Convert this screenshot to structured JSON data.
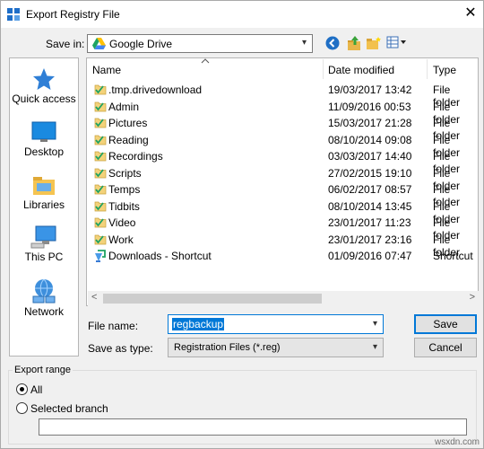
{
  "window": {
    "title": "Export Registry File",
    "close_symbol": "✕"
  },
  "location": {
    "label": "Save in:",
    "current": "Google Drive"
  },
  "places": [
    {
      "label": "Quick access",
      "icon": "star-icon"
    },
    {
      "label": "Desktop",
      "icon": "desktop-icon"
    },
    {
      "label": "Libraries",
      "icon": "libraries-icon"
    },
    {
      "label": "This PC",
      "icon": "computer-icon"
    },
    {
      "label": "Network",
      "icon": "network-icon"
    }
  ],
  "columns": {
    "name": "Name",
    "date": "Date modified",
    "type": "Type"
  },
  "files": [
    {
      "name": ".tmp.drivedownload",
      "date": "19/03/2017 13:42",
      "type": "File folder",
      "icon": "synced-folder-icon"
    },
    {
      "name": "Admin",
      "date": "11/09/2016 00:53",
      "type": "File folder",
      "icon": "synced-folder-icon"
    },
    {
      "name": "Pictures",
      "date": "15/03/2017 21:28",
      "type": "File folder",
      "icon": "synced-folder-icon"
    },
    {
      "name": "Reading",
      "date": "08/10/2014 09:08",
      "type": "File folder",
      "icon": "synced-folder-icon"
    },
    {
      "name": "Recordings",
      "date": "03/03/2017 14:40",
      "type": "File folder",
      "icon": "synced-folder-icon"
    },
    {
      "name": "Scripts",
      "date": "27/02/2015 19:10",
      "type": "File folder",
      "icon": "synced-folder-icon"
    },
    {
      "name": "Temps",
      "date": "06/02/2017 08:57",
      "type": "File folder",
      "icon": "synced-folder-icon"
    },
    {
      "name": "Tidbits",
      "date": "08/10/2014 13:45",
      "type": "File folder",
      "icon": "synced-folder-icon"
    },
    {
      "name": "Video",
      "date": "23/01/2017 11:23",
      "type": "File folder",
      "icon": "synced-folder-icon"
    },
    {
      "name": "Work",
      "date": "23/01/2017 23:16",
      "type": "File folder",
      "icon": "synced-folder-icon"
    },
    {
      "name": "Downloads - Shortcut",
      "date": "01/09/2016 07:47",
      "type": "Shortcut",
      "icon": "shortcut-icon"
    }
  ],
  "form": {
    "filename_label": "File name:",
    "filename_value": "regbackup",
    "type_label": "Save as type:",
    "type_value": "Registration Files (*.reg)",
    "save_label": "Save",
    "cancel_label": "Cancel"
  },
  "export_range": {
    "title": "Export range",
    "all_label": "All",
    "branch_label": "Selected branch",
    "selected": "All",
    "branch_value": ""
  },
  "watermark": "wsxdn.com"
}
